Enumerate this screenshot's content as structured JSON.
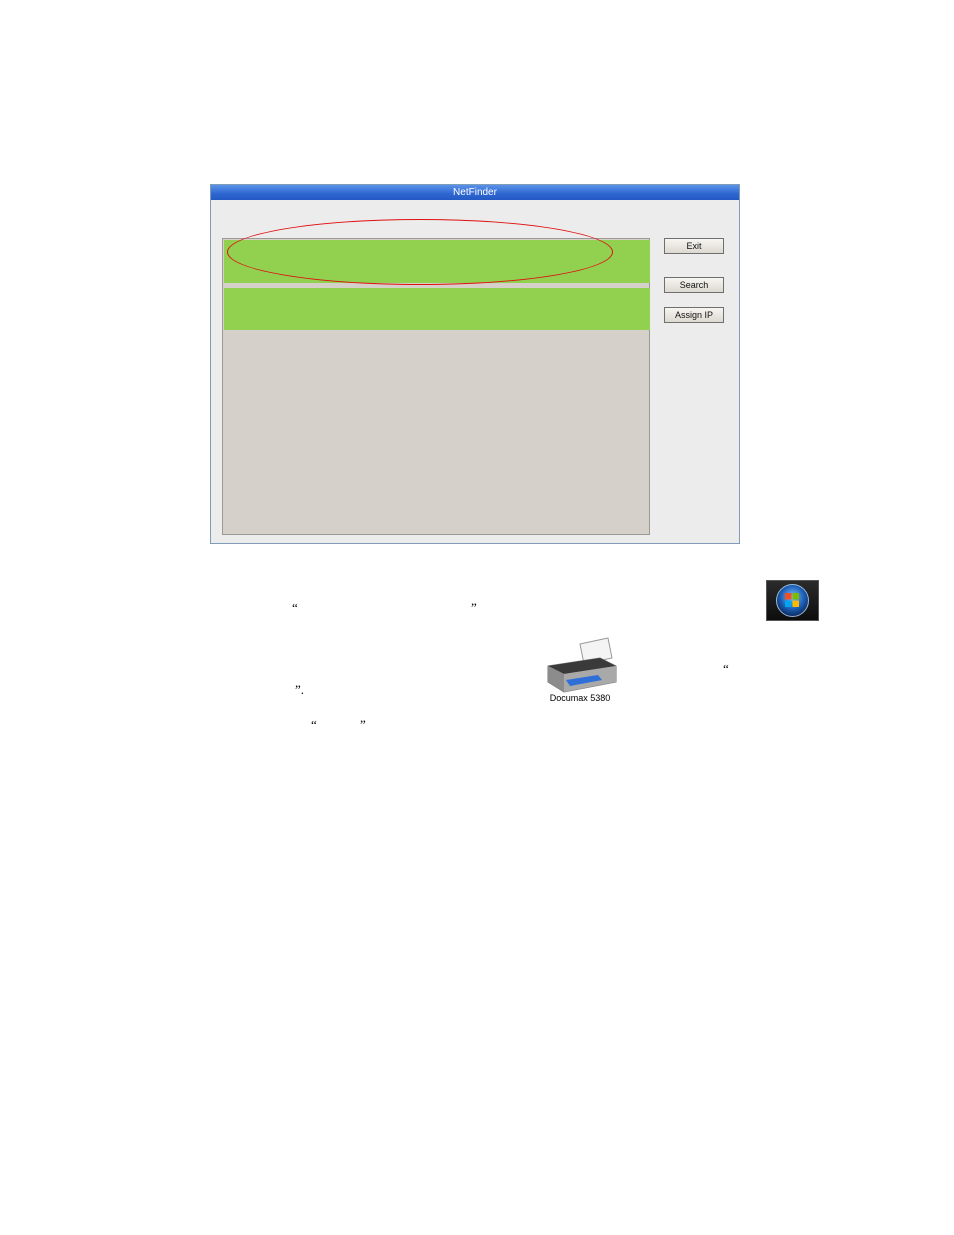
{
  "window": {
    "title": "NetFinder"
  },
  "buttons": {
    "exit": "Exit",
    "search": "Search",
    "assign_ip": "Assign IP"
  },
  "doc": {
    "open_quote": "“",
    "close_quote": "”",
    "close_quote_period": "”.",
    "printer_label": "Documax 5380"
  },
  "colors": {
    "highlight_row": "#92d050",
    "annotation": "#e01010"
  },
  "icons": [
    "windows-start-orb-icon",
    "printer-icon"
  ]
}
